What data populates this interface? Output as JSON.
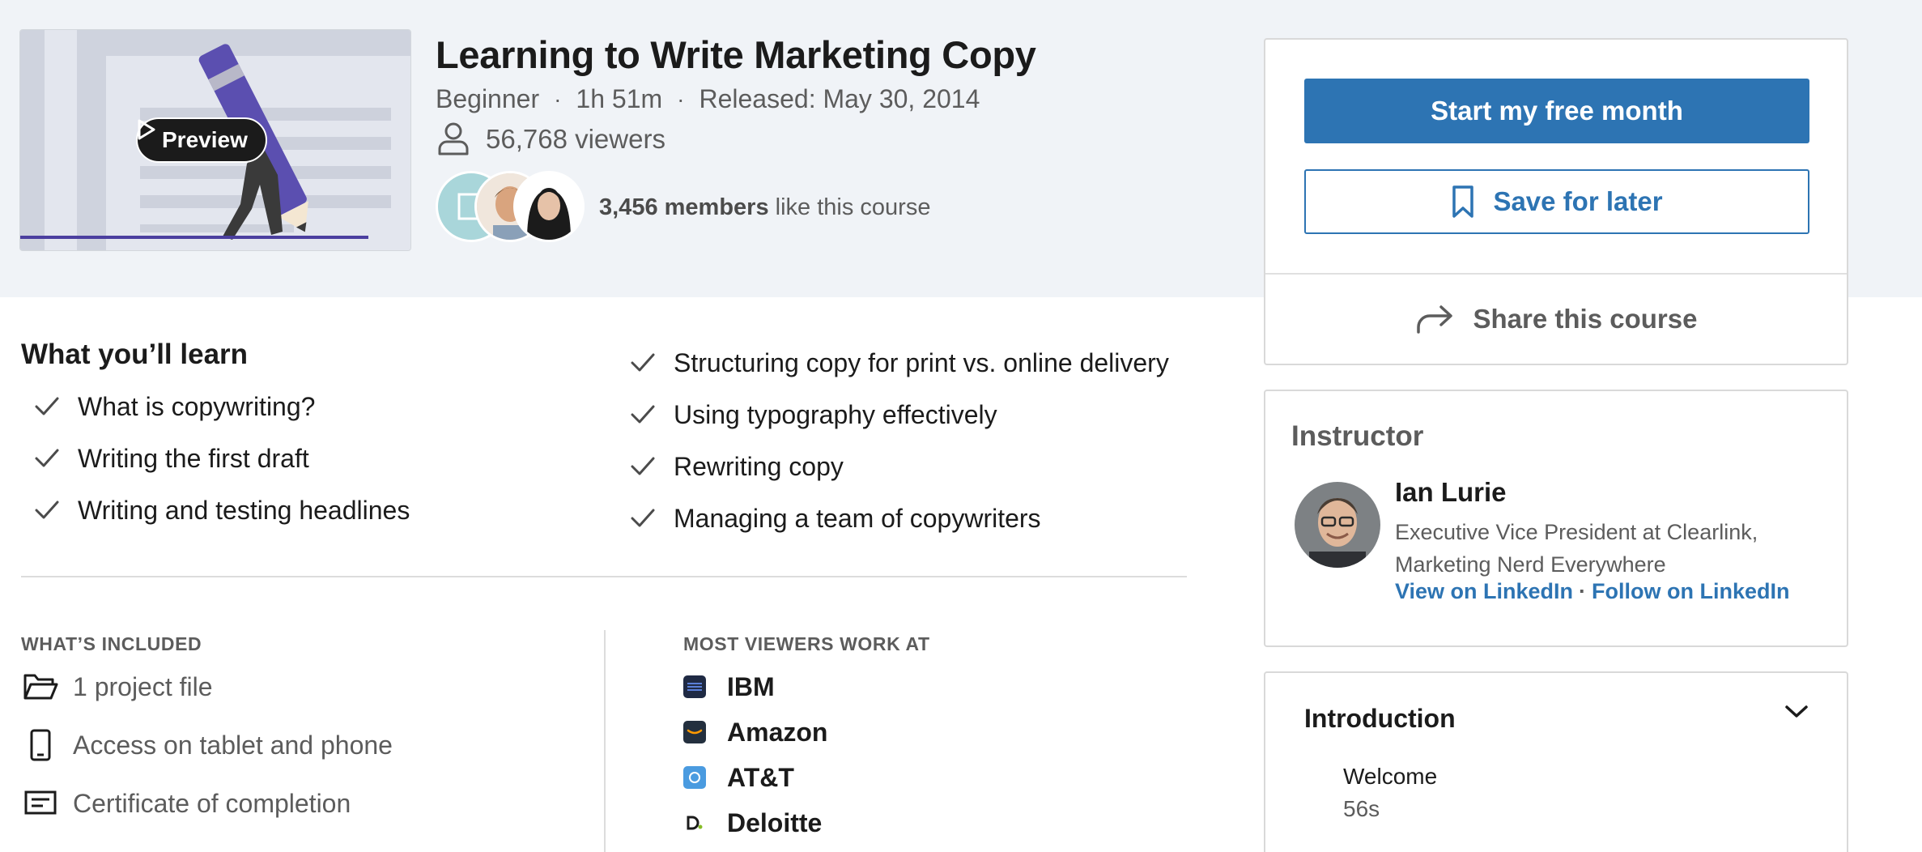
{
  "hero": {
    "preview_label": "Preview",
    "title": "Learning to Write Marketing Copy",
    "level": "Beginner",
    "duration": "1h 51m",
    "released": "Released: May 30, 2014",
    "viewers": "56,768 viewers",
    "likes_count": "3,456 members",
    "likes_suffix": " like this course",
    "meta_sep": "·"
  },
  "cta": {
    "start_label": "Start my free month",
    "save_label": "Save for later",
    "share_label": "Share this course"
  },
  "instructor": {
    "heading": "Instructor",
    "name": "Ian Lurie",
    "bio": "Executive Vice President at Clearlink, Marketing Nerd Everywhere",
    "view_link": "View on LinkedIn",
    "link_sep": "·",
    "follow_link": "Follow on LinkedIn"
  },
  "toc": {
    "section_title": "Introduction",
    "item_title": "Welcome",
    "item_duration": "56s"
  },
  "learn": {
    "heading": "What you’ll learn",
    "left": [
      "What is copywriting?",
      "Writing the first draft",
      "Writing and testing headlines"
    ],
    "right": [
      "Structuring copy for print vs. online delivery",
      "Using typography effectively",
      "Rewriting copy",
      "Managing a team of copywriters"
    ]
  },
  "included": {
    "heading": "WHAT’S INCLUDED",
    "items": [
      {
        "icon": "folder-icon",
        "label": "1 project file"
      },
      {
        "icon": "phone-icon",
        "label": "Access on tablet and phone"
      },
      {
        "icon": "certificate-icon",
        "label": "Certificate of completion"
      }
    ]
  },
  "companies": {
    "heading": "MOST VIEWERS WORK AT",
    "items": [
      {
        "name": "IBM",
        "logo_color": "#1f2a44"
      },
      {
        "name": "Amazon",
        "logo_color": "#232f3e"
      },
      {
        "name": "AT&T",
        "logo_color": "#4a9be0"
      },
      {
        "name": "Deloitte",
        "logo_color": "#ffffff"
      }
    ]
  },
  "colors": {
    "accent": "#2d74b3",
    "hero_bg": "#f0f3f7",
    "text_muted": "#5c5c5c"
  }
}
